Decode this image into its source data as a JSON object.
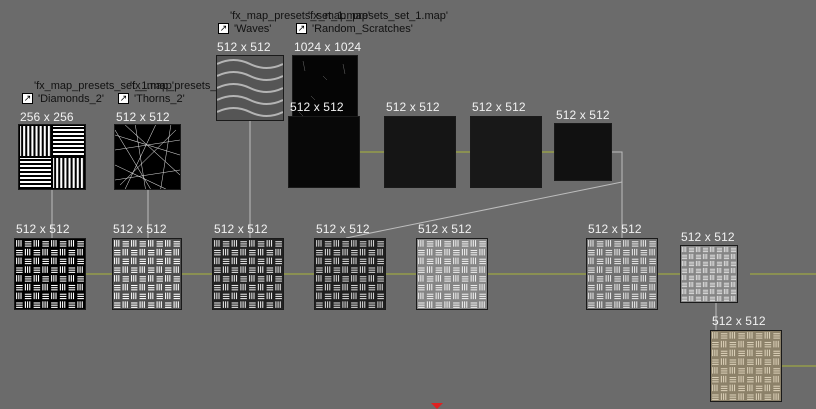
{
  "graph": {
    "references": [
      {
        "file": "'fx_map_presets_set_1.map'",
        "name": "'Diamonds_2'",
        "icon": "shortcut-arrow-icon"
      },
      {
        "file": "'fx_map_presets_set_1.map'",
        "name": "'Thorns_2'",
        "icon": "shortcut-arrow-icon"
      },
      {
        "file": "'fx_map_presets_set_1.map'",
        "name": "'Waves'",
        "icon": "shortcut-arrow-icon"
      },
      {
        "file": "'fx_map_presets_set_1.map'",
        "name": "'Random_Scratches'",
        "icon": "shortcut-arrow-icon"
      }
    ],
    "nodes": [
      {
        "id": "diamonds",
        "res": "256 x 256"
      },
      {
        "id": "thorns",
        "res": "512 x 512"
      },
      {
        "id": "waves",
        "res": "512 x 512"
      },
      {
        "id": "scratches",
        "res": "1024 x 1024"
      },
      {
        "id": "dark1",
        "res": "512 x 512"
      },
      {
        "id": "dark2",
        "res": "512 x 512"
      },
      {
        "id": "dark3",
        "res": "512 x 512"
      },
      {
        "id": "dark4",
        "res": "512 x 512"
      },
      {
        "id": "weave1",
        "res": "512 x 512"
      },
      {
        "id": "weave2",
        "res": "512 x 512"
      },
      {
        "id": "weave3",
        "res": "512 x 512"
      },
      {
        "id": "weave4",
        "res": "512 x 512"
      },
      {
        "id": "weave5",
        "res": "512 x 512"
      },
      {
        "id": "weave6",
        "res": "512 x 512"
      },
      {
        "id": "weave7",
        "res": "512 x 512"
      },
      {
        "id": "final",
        "res": "512 x 512"
      }
    ]
  },
  "colors": {
    "background": "#6b6b6b",
    "wire": "#a8b43a",
    "wire_gray": "#bdbdbd",
    "scroll_marker": "#e02020"
  }
}
